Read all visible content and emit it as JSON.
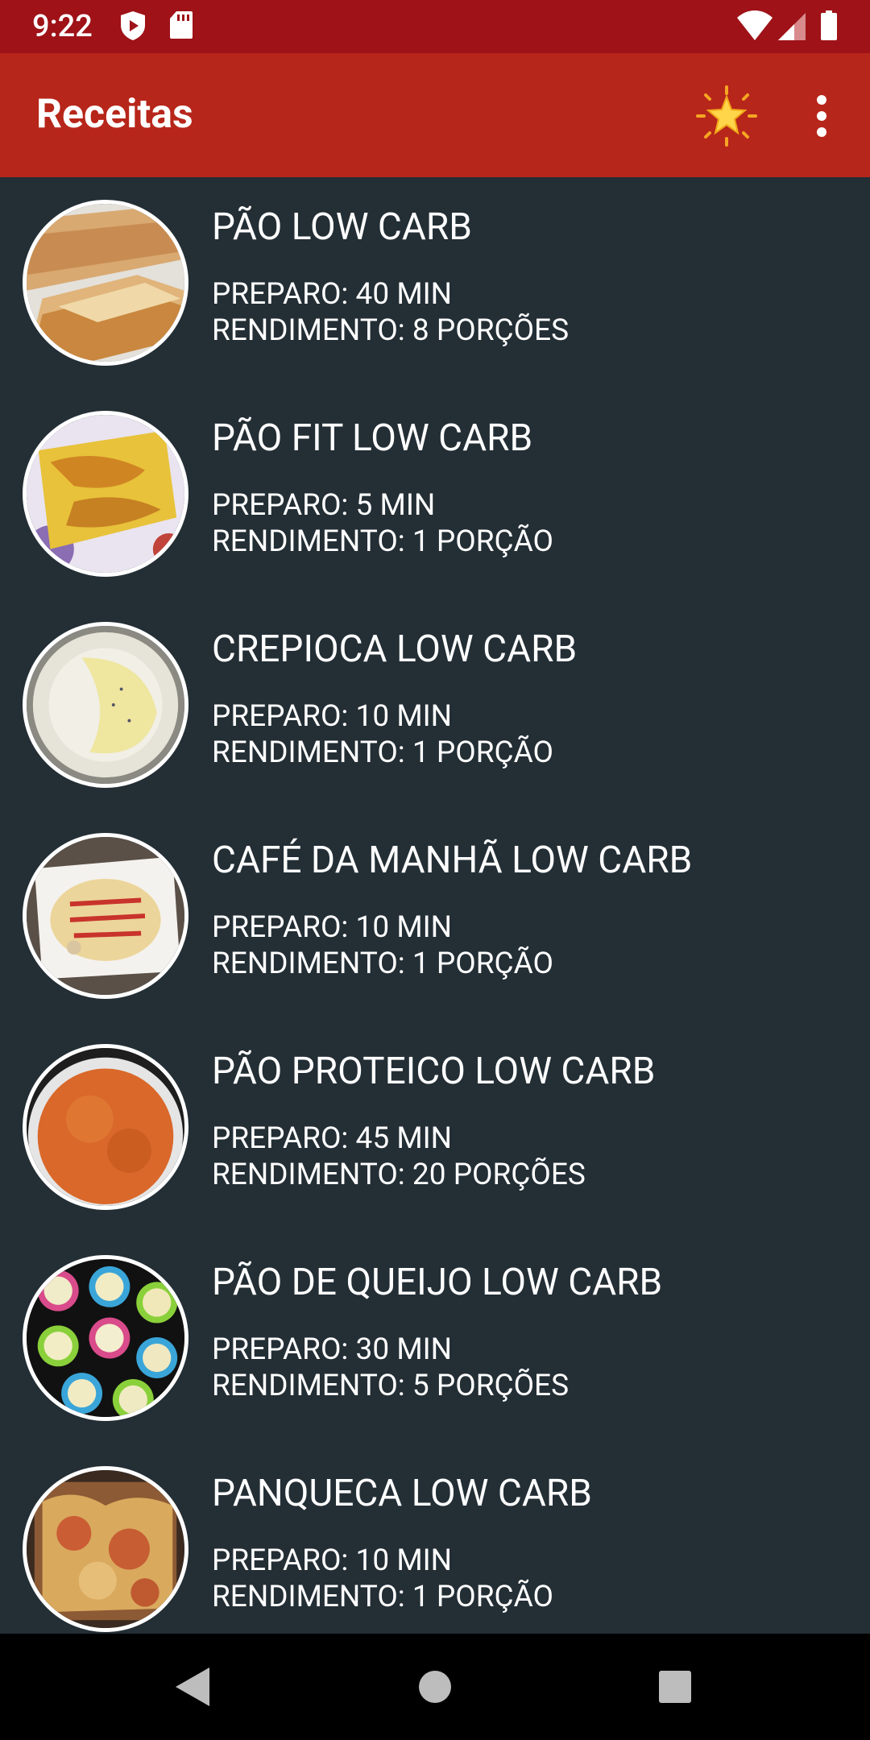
{
  "status_bar": {
    "time": "9:22",
    "icons": [
      "shield-icon",
      "sd-card-icon",
      "wifi-icon",
      "cell-signal-icon",
      "battery-icon"
    ]
  },
  "app_bar": {
    "title": "Receitas",
    "actions": [
      "star-icon",
      "more-vert-icon"
    ],
    "color": "#b7261a"
  },
  "recipes": [
    {
      "name": "PÃO LOW CARB",
      "prep": "PREPARO: 40 MIN",
      "yield": "RENDIMENTO: 8 PORÇÕES",
      "image": "bread-loaf-photo"
    },
    {
      "name": "PÃO FIT LOW CARB",
      "prep": "PREPARO: 5 MIN",
      "yield": "RENDIMENTO: 1 PORÇÃO",
      "image": "fit-bread-photo"
    },
    {
      "name": "CREPIOCA LOW CARB",
      "prep": "PREPARO: 10 MIN",
      "yield": "RENDIMENTO: 1 PORÇÃO",
      "image": "crepioca-photo"
    },
    {
      "name": "CAFÉ DA MANHÃ LOW CARB",
      "prep": "PREPARO: 10 MIN",
      "yield": "RENDIMENTO: 1 PORÇÃO",
      "image": "breakfast-photo"
    },
    {
      "name": "PÃO PROTEICO LOW CARB",
      "prep": "PREPARO: 45 MIN",
      "yield": "RENDIMENTO: 20 PORÇÕES",
      "image": "protein-bread-photo"
    },
    {
      "name": "PÃO DE QUEIJO LOW CARB",
      "prep": "PREPARO: 30 MIN",
      "yield": "RENDIMENTO: 5 PORÇÕES",
      "image": "cheese-bread-photo"
    },
    {
      "name": "PANQUECA LOW CARB",
      "prep": "PREPARO: 10 MIN",
      "yield": "RENDIMENTO: 1 PORÇÃO",
      "image": "pancake-photo"
    }
  ],
  "nav_bar": {
    "buttons": [
      "back-icon",
      "home-icon",
      "recents-icon"
    ]
  },
  "colors": {
    "status_bar": "#9e1218",
    "app_bar": "#b7261a",
    "list_background": "#232e35",
    "text": "#ffffff"
  }
}
